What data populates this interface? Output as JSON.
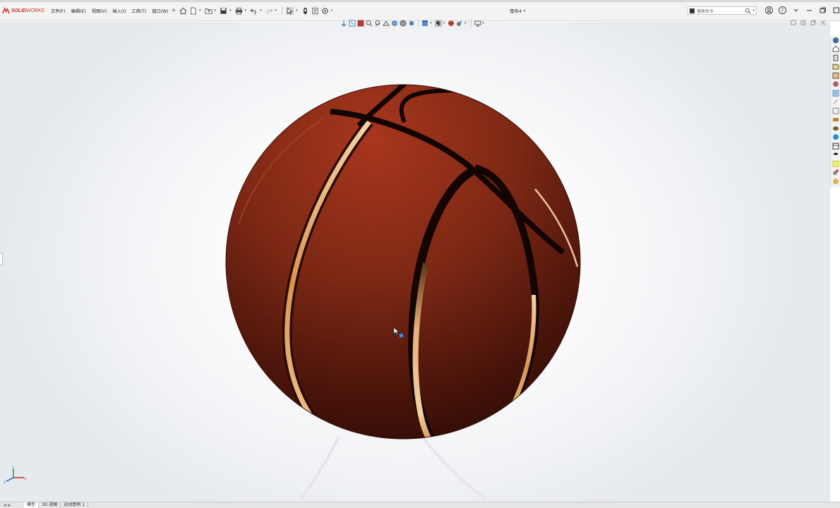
{
  "app": {
    "brand_prefix": "3S",
    "brand_part1": "SOLID",
    "brand_part2": "WORKS",
    "document_title": "零件4 *"
  },
  "menu": [
    {
      "label": "文件(F)"
    },
    {
      "label": "编辑(E)"
    },
    {
      "label": "视图(V)"
    },
    {
      "label": "插入(I)"
    },
    {
      "label": "工具(T)"
    },
    {
      "label": "窗口(W)"
    }
  ],
  "search": {
    "placeholder": "搜索命令"
  },
  "quick_toolbar_icons": [
    "home-icon",
    "new-document-icon",
    "open-icon",
    "save-icon",
    "print-icon",
    "undo-icon",
    "redo-icon",
    "select-icon",
    "rebuild-icon",
    "file-properties-icon",
    "options-icon"
  ],
  "view_toolbar_icons": [
    "view-orientation-icon",
    "zoom-to-fit-icon",
    "zoom-area-icon",
    "previous-view-icon",
    "section-view-icon",
    "dynamic-annotation-icon",
    "view-orientation-cube-icon",
    "display-style-icon",
    "hide-show-icon",
    "edit-appearance-icon",
    "apply-scene-icon",
    "view-settings-icon",
    "display-pane-icon"
  ],
  "task_pane_icons": [
    "solidworks-resources-icon",
    "design-library-icon",
    "file-explorer-icon",
    "view-palette-icon",
    "appearances-icon",
    "custom-properties-icon",
    "toolbox-icon",
    "3d-content-icon",
    "forum-icon",
    "materials-icon",
    "plugin-icon",
    "document-recovery-icon",
    "learning-icon",
    "note-icon",
    "settings-icon",
    "addin-icon"
  ],
  "bottom_tabs": [
    {
      "label": "模型",
      "active": true
    },
    {
      "label": "3D 视图",
      "active": false
    },
    {
      "label": "运动算例 1",
      "active": false
    }
  ],
  "colors": {
    "brand_red": "#d52b1e",
    "ball_base": "#8a2c1a",
    "seam_gold": "#e8b27a",
    "seam_dark": "#1a0704"
  }
}
